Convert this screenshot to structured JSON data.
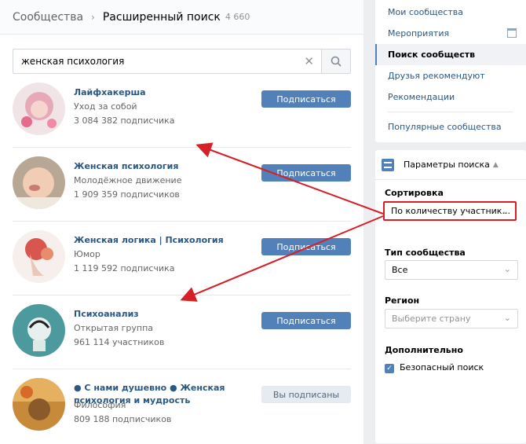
{
  "header": {
    "breadcrumb": "Сообщества",
    "title": "Расширенный поиск",
    "count": "4 660"
  },
  "search": {
    "value": "женская психология"
  },
  "results": [
    {
      "name": "Лайфхакерша",
      "category": "Уход за собой",
      "members": "3 084 382 подписчика",
      "button": "Подписаться"
    },
    {
      "name": "Женская психология",
      "category": "Молодёжное движение",
      "members": "1 909 359 подписчиков",
      "button": "Подписаться"
    },
    {
      "name": "Женская логика | Психология",
      "category": "Юмор",
      "members": "1 119 592 подписчика",
      "button": "Подписаться"
    },
    {
      "name": "Психоанализ",
      "category": "Открытая группа",
      "members": "961 114 участников",
      "button": "Подписаться"
    },
    {
      "name": "● С нами душевно ● Женская психология и мудрость",
      "category": "Философия",
      "members": "809 188 подписчиков",
      "button": "Вы подписаны"
    }
  ],
  "menu": {
    "items": [
      "Мои сообщества",
      "Мероприятия",
      "Поиск сообществ",
      "Друзья рекомендуют",
      "Рекомендации"
    ],
    "popular": "Популярные сообщества"
  },
  "filters": {
    "header": "Параметры поиска",
    "sort_label": "Сортировка",
    "sort_value": "По количеству участник...",
    "type_label": "Тип сообщества",
    "type_value": "Все",
    "region_label": "Регион",
    "region_placeholder": "Выберите страну",
    "extra_label": "Дополнительно",
    "safe_search": "Безопасный поиск"
  },
  "colors": {
    "accent": "#5181b8",
    "link": "#2a5885",
    "annotation_red": "#d61f26"
  }
}
